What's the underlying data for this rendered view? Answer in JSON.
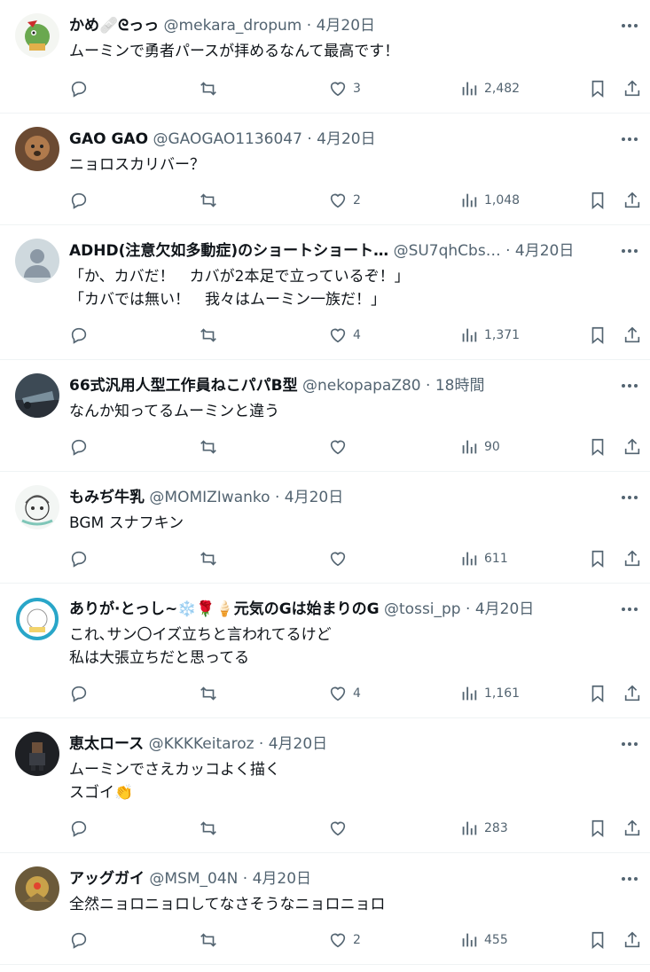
{
  "tweets": [
    {
      "name": "かめ🩹ᘓっっ",
      "handle": "@mekara_dropum",
      "time": "4月20日",
      "text": "ムーミンで勇者パースが拝めるなんて最高です！",
      "replies": "",
      "retweets": "",
      "likes": "3",
      "views": "2,482",
      "avatar_icon": "dragon-mascot-avatar"
    },
    {
      "name": "GAO GAO",
      "handle": "@GAOGAO1136047",
      "time": "4月20日",
      "text": "ニョロスカリバー？",
      "replies": "",
      "retweets": "",
      "likes": "2",
      "views": "1,048",
      "avatar_icon": "dog-photo-avatar"
    },
    {
      "name": "ADHD(注意欠如多動症)のショートショート…",
      "handle": "@SU7qhCbs…",
      "time": "4月20日",
      "text": "「か、カバだ！　カバが2本足で立っているぞ！」\n「カバでは無い！　我々はムーミン一族だ！」",
      "replies": "",
      "retweets": "",
      "likes": "4",
      "views": "1,371",
      "avatar_icon": "default-user-avatar"
    },
    {
      "name": "66式汎用人型工作員ねこパパB型",
      "handle": "@nekopapaZ80",
      "time": "18時間",
      "text": "なんか知ってるムーミンと違う",
      "replies": "",
      "retweets": "",
      "likes": "",
      "views": "90",
      "avatar_icon": "vehicle-photo-avatar"
    },
    {
      "name": "もみぢ牛乳",
      "handle": "@MOMIZIwanko",
      "time": "4月20日",
      "text": "BGM スナフキン",
      "replies": "",
      "retweets": "",
      "likes": "",
      "views": "611",
      "avatar_icon": "anime-sketch-avatar"
    },
    {
      "name": "ありが·とっし~❄️🌹🍦元気のGは始まりのG",
      "handle": "@tossi_pp",
      "time": "4月20日",
      "text": "これ､サン〇イズ立ちと言われてるけど\n私は大張立ちだと思ってる",
      "replies": "",
      "retweets": "",
      "likes": "4",
      "views": "1,161",
      "avatar_icon": "badge-logo-avatar"
    },
    {
      "name": "恵太ロース",
      "handle": "@KKKKeitaroz",
      "time": "4月20日",
      "text": "ムーミンでさえカッコよく描く\nスゴイ👏",
      "replies": "",
      "retweets": "",
      "likes": "",
      "views": "283",
      "avatar_icon": "pixel-character-avatar"
    },
    {
      "name": "アッグガイ",
      "handle": "@MSM_04N",
      "time": "4月20日",
      "text": "全然ニョロニョロしてなさそうなニョロニョロ",
      "replies": "",
      "retweets": "",
      "likes": "2",
      "views": "455",
      "avatar_icon": "robot-figure-avatar"
    }
  ],
  "colors": {
    "text": "#0f1419",
    "secondary": "#536471",
    "divider": "#eff3f4"
  }
}
